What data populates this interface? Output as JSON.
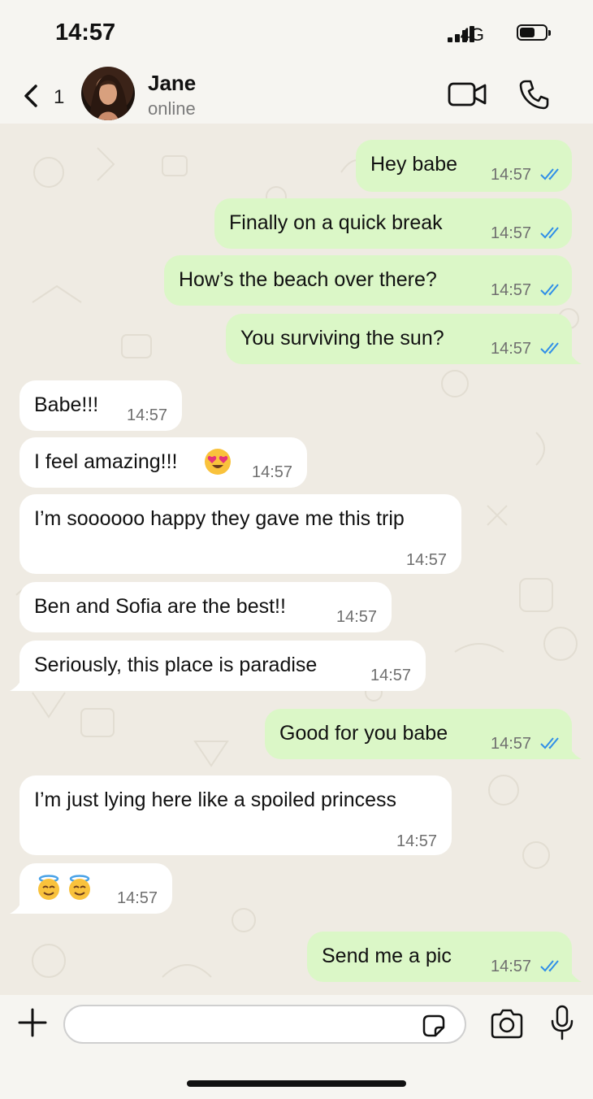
{
  "status_bar": {
    "time": "14:57",
    "network": "4G"
  },
  "header": {
    "back_count": "1",
    "contact_name": "Jane",
    "contact_status": "online"
  },
  "messages": [
    {
      "dir": "out",
      "text": "Hey babe",
      "time": "14:57"
    },
    {
      "dir": "out",
      "text": "Finally on a quick break",
      "time": "14:57"
    },
    {
      "dir": "out",
      "text": "How’s the beach over there?",
      "time": "14:57"
    },
    {
      "dir": "out",
      "text": "You surviving the sun?",
      "time": "14:57"
    },
    {
      "dir": "in",
      "text": "Babe!!!",
      "time": "14:57"
    },
    {
      "dir": "in",
      "text": "I feel amazing!!!",
      "emoji": "heart-eyes",
      "time": "14:57"
    },
    {
      "dir": "in",
      "text": "I’m soooooo happy they gave me this trip",
      "time": "14:57"
    },
    {
      "dir": "in",
      "text": "Ben and Sofia are the best!!",
      "time": "14:57"
    },
    {
      "dir": "in",
      "text": "Seriously, this place is paradise",
      "time": "14:57"
    },
    {
      "dir": "out",
      "text": "Good for you babe",
      "time": "14:57"
    },
    {
      "dir": "in",
      "text": "I’m just lying here like a spoiled princess",
      "time": "14:57"
    },
    {
      "dir": "in",
      "text": "",
      "emoji": "smiling-face-with-halo x2",
      "time": "14:57"
    },
    {
      "dir": "out",
      "text": "Send me a pic",
      "time": "14:57"
    }
  ],
  "colors": {
    "outgoing_bubble": "#dbf7c7",
    "incoming_bubble": "#ffffff",
    "read_ticks": "#2f8ee8",
    "chat_background": "#efebe3"
  }
}
